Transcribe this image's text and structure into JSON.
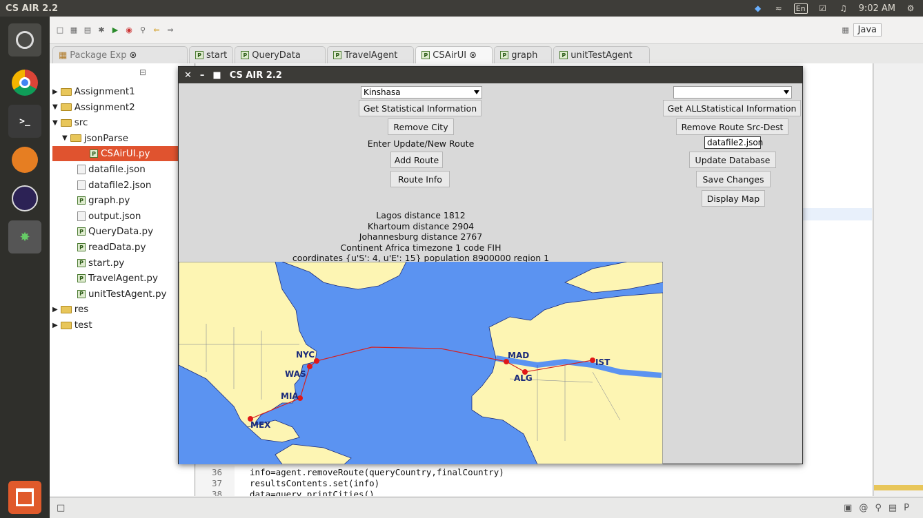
{
  "topbar": {
    "title": "CS AIR 2.2",
    "lang": "En",
    "clock": "9:02 AM"
  },
  "toolbar": {
    "perspective": "Java"
  },
  "tabs": [
    {
      "label": "Package Exp",
      "icon": "package-icon"
    },
    {
      "label": "start"
    },
    {
      "label": "QueryData"
    },
    {
      "label": "TravelAgent"
    },
    {
      "label": "CSAirUI",
      "active": true
    },
    {
      "label": "graph"
    },
    {
      "label": "unitTestAgent"
    }
  ],
  "tree": [
    {
      "label": "Assignment1",
      "indent": 0
    },
    {
      "label": "Assignment2",
      "indent": 0
    },
    {
      "label": "src",
      "indent": 1
    },
    {
      "label": "jsonParse",
      "indent": 2
    },
    {
      "label": "CSAirUI.py",
      "indent": 3,
      "selected": true
    },
    {
      "label": "datafile.json",
      "indent": 3
    },
    {
      "label": "datafile2.json",
      "indent": 3
    },
    {
      "label": "graph.py",
      "indent": 3
    },
    {
      "label": "output.json",
      "indent": 3
    },
    {
      "label": "QueryData.py",
      "indent": 3
    },
    {
      "label": "readData.py",
      "indent": 3
    },
    {
      "label": "start.py",
      "indent": 3
    },
    {
      "label": "TravelAgent.py",
      "indent": 3
    },
    {
      "label": "unitTestAgent.py",
      "indent": 3
    },
    {
      "label": "res",
      "indent": 1
    },
    {
      "label": "test",
      "indent": 1
    }
  ],
  "code": [
    {
      "line": "36",
      "text": "info=agent.removeRoute(queryCountry,finalCountry)"
    },
    {
      "line": "37",
      "text": "resultsContents.set(info)"
    },
    {
      "line": "38",
      "text": "data=query.printCities()"
    }
  ],
  "app": {
    "title": "CS AIR 2.2",
    "city_select": "Kinshasa",
    "right_select": "",
    "btn_stats": "Get Statistical Information",
    "btn_all_stats": "Get ALLStatistical Information",
    "btn_remove_city": "Remove City",
    "btn_remove_route": "Remove Route Src-Dest",
    "route_label": "Enter Update/New Route",
    "file_input": "datafile2.json",
    "btn_add_route": "Add Route",
    "btn_update_db": "Update Database",
    "btn_route_info": "Route Info",
    "btn_save": "Save Changes",
    "btn_map": "Display Map",
    "info_lines": [
      "Lagos distance 1812",
      "Khartoum distance 2904",
      "Johannesburg distance 2767",
      "Continent Africa timezone 1 code FIH",
      "coordinates {u'S': 4, u'E': 15} population 8900000 region 1"
    ],
    "cities": [
      "NYC",
      "WAS",
      "MIA",
      "MEX",
      "MAD",
      "ALG",
      "IST"
    ]
  }
}
